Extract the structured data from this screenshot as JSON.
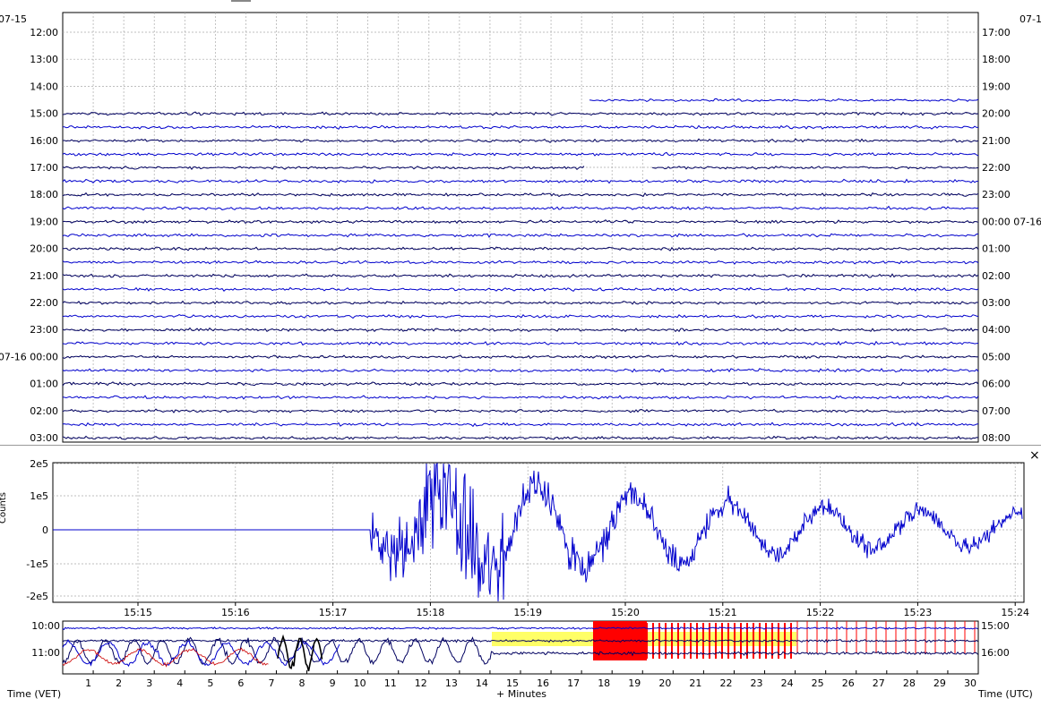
{
  "helicorder": {
    "left_date": "07-15",
    "right_date": "07-1",
    "left_labels": [
      "12:00",
      "13:00",
      "14:00",
      "15:00",
      "16:00",
      "17:00",
      "18:00",
      "19:00",
      "20:00",
      "21:00",
      "22:00",
      "23:00",
      "07-16 00:00",
      "01:00",
      "02:00",
      "03:00"
    ],
    "right_labels": [
      "17:00",
      "18:00",
      "19:00",
      "20:00",
      "21:00",
      "22:00",
      "23:00",
      "00:00 07-16",
      "01:00",
      "02:00",
      "03:00",
      "04:00",
      "05:00",
      "06:00",
      "07:00",
      "08:00"
    ],
    "trace_colors": [
      "#000060",
      "#0000cc"
    ]
  },
  "zoom": {
    "close_label": "×",
    "ylabel": "Counts",
    "y_tick_labels": [
      "2e5",
      "1e5",
      "0",
      "-1e5",
      "-2e5"
    ],
    "x_tick_labels": [
      "15:15",
      "15:16",
      "15:17",
      "15:18",
      "15:19",
      "15:20",
      "15:21",
      "15:22",
      "15:23",
      "15:24"
    ],
    "trace_color": "#0000cc"
  },
  "overview": {
    "left_labels": [
      "10:00",
      "11:00"
    ],
    "right_labels": [
      "15:00",
      "16:00"
    ],
    "minute_ticks": [
      "1",
      "2",
      "3",
      "4",
      "5",
      "6",
      "7",
      "8",
      "9",
      "10",
      "11",
      "12",
      "13",
      "14",
      "15",
      "16",
      "17",
      "18",
      "19",
      "20",
      "21",
      "22",
      "23",
      "24",
      "25",
      "26",
      "27",
      "28",
      "29",
      "30"
    ],
    "left_axis_label": "Time (VET)",
    "center_axis_label": "+ Minutes",
    "right_axis_label": "Time (UTC)",
    "highlight_colors": {
      "yellow": "#ffff66",
      "red": "#ff0000"
    }
  }
}
